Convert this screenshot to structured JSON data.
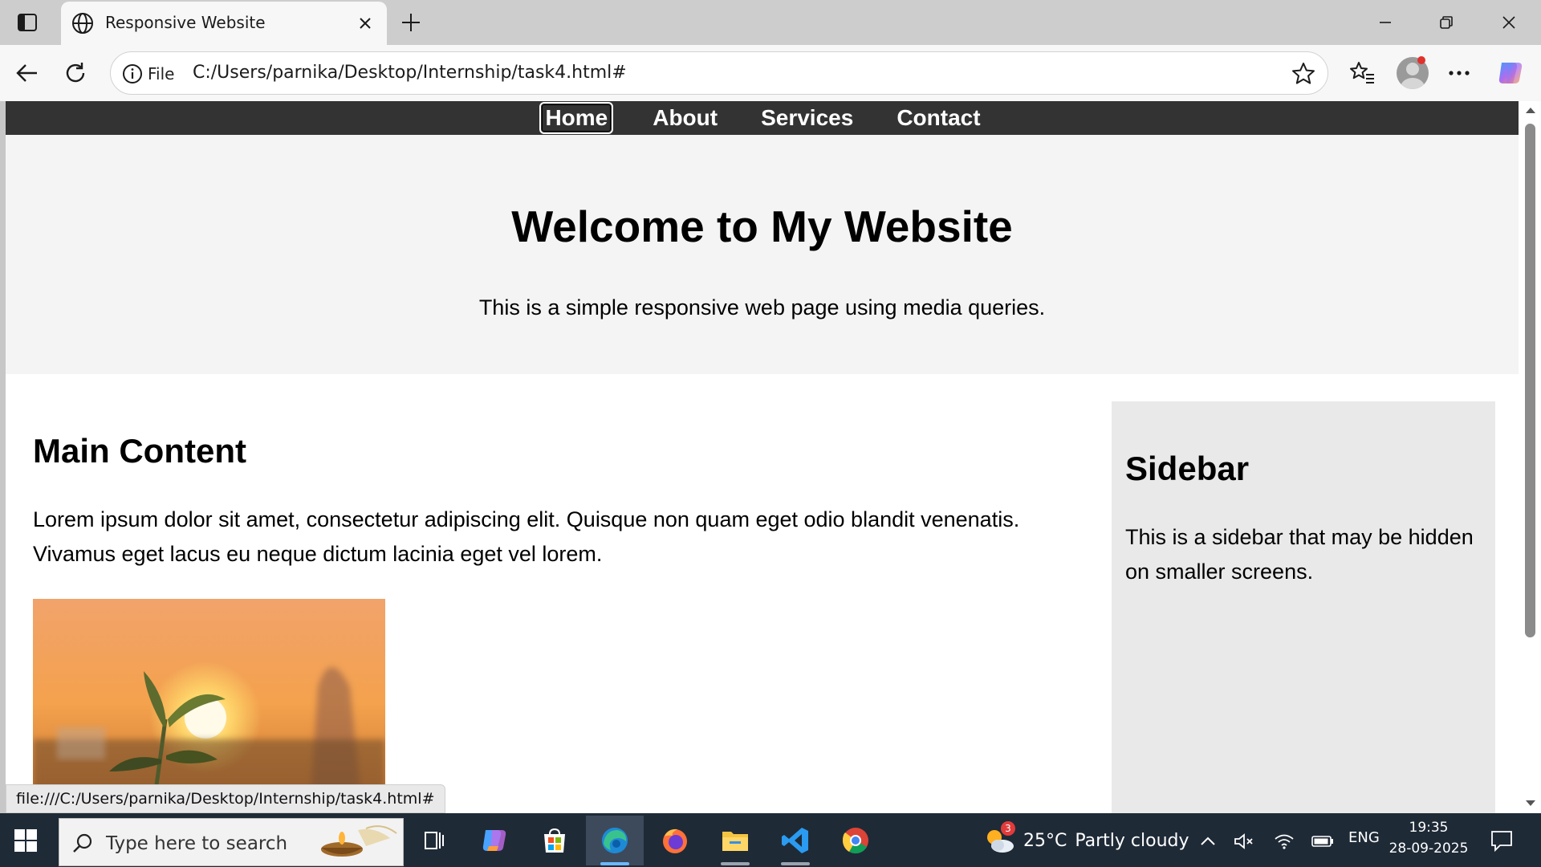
{
  "browser": {
    "tab_title": "Responsive Website",
    "address_scheme_label": "File",
    "address_url": "C:/Users/parnika/Desktop/Internship/task4.html#",
    "status_link": "file:///C:/Users/parnika/Desktop/Internship/task4.html#"
  },
  "page": {
    "nav": [
      {
        "label": "Home"
      },
      {
        "label": "About"
      },
      {
        "label": "Services"
      },
      {
        "label": "Contact"
      }
    ],
    "hero": {
      "title": "Welcome to My Website",
      "subtitle": "This is a simple responsive web page using media queries."
    },
    "main": {
      "heading": "Main Content",
      "body": "Lorem ipsum dolor sit amet, consectetur adipiscing elit. Quisque non quam eget odio blandit venenatis. Vivamus eget lacus eu neque dictum lacinia eget vel lorem."
    },
    "sidebar": {
      "heading": "Sidebar",
      "body": "This is a sidebar that may be hidden on smaller screens."
    }
  },
  "taskbar": {
    "search_placeholder": "Type here to search",
    "weather_temp": "25°C",
    "weather_desc": "Partly cloudy",
    "weather_badge": "3",
    "language": "ENG",
    "time": "19:35",
    "date": "28-09-2025"
  }
}
